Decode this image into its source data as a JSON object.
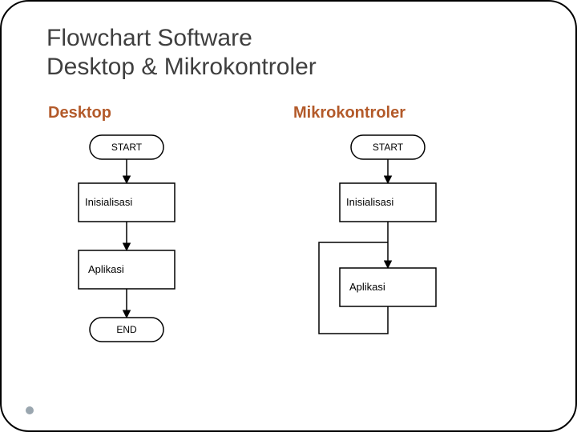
{
  "title_line1": "Flowchart Software",
  "title_line2": "Desktop & Mikrokontroler",
  "left": {
    "heading": "Desktop",
    "nodes": {
      "start": "START",
      "init": "Inisialisasi",
      "app": "Aplikasi",
      "end": "END"
    }
  },
  "right": {
    "heading": "Mikrokontroler",
    "nodes": {
      "start": "START",
      "init": "Inisialisasi",
      "app": "Aplikasi"
    }
  }
}
